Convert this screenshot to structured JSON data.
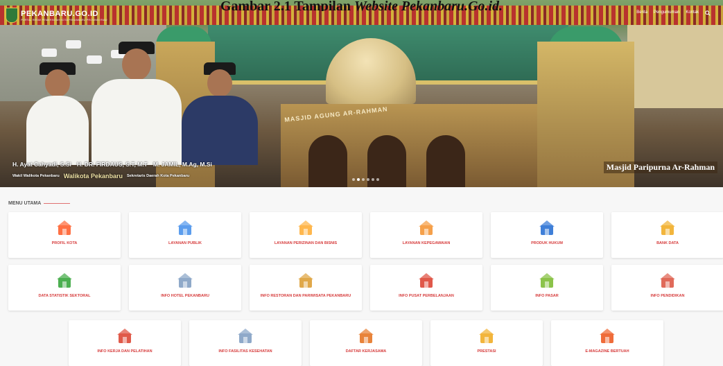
{
  "caption": {
    "prefix": "Gambar 2.1 Tampilan ",
    "italic": "Website Pekanbaru.Go.id."
  },
  "header": {
    "logo_title": "PEKANBARU.GO.ID",
    "logo_subtitle": "PORTAL RESMI PEMERINTAH KOTA PEKANBARU PROVINSI RIAU",
    "nav": [
      "Berita",
      "Pengumuman",
      "Kontak"
    ]
  },
  "hero": {
    "officials": [
      {
        "name": "H. Ayat Cahyadi, S.Si",
        "role": "Wakil Walikota Pekanbaru"
      },
      {
        "name": "H. DR. FIRDAUS, S.T, M.T",
        "role": "Walikota Pekanbaru"
      },
      {
        "name": "M. JAMIL, M.Ag, M.Si",
        "role": "Sekretaris Daerah Kota Pekanbaru"
      }
    ],
    "building_sign": "MASJID AGUNG AR-RAHMAN",
    "place_label": "Masjid Paripurna Ar-Rahman",
    "slide_count": 6,
    "active_slide": 1
  },
  "menu": {
    "title": "MENU UTAMA",
    "items": [
      {
        "label": "PROFIL KOTA",
        "icon": "home-icon",
        "color": "#ff7043"
      },
      {
        "label": "LAYANAN PUBLIK",
        "icon": "public-service-icon",
        "color": "#5c9ded"
      },
      {
        "label": "LAYANAN PERIZINAN DAN BISNIS",
        "icon": "business-permit-icon",
        "color": "#ffb74d"
      },
      {
        "label": "LAYANAN KEPEGAWAIAN",
        "icon": "employee-icon",
        "color": "#f5a04a"
      },
      {
        "label": "PRODUK HUKUM",
        "icon": "globe-law-icon",
        "color": "#3f7fd8"
      },
      {
        "label": "BANK DATA",
        "icon": "database-icon",
        "color": "#f2b53c"
      },
      {
        "label": "DATA STATISTIK SEKTORAL",
        "icon": "statistics-chart-icon",
        "color": "#4caf50"
      },
      {
        "label": "INFO HOTEL PEKANBARU",
        "icon": "hotel-icon",
        "color": "#8fa9c9"
      },
      {
        "label": "INFO RESTORAN DAN PARIWISATA PEKANBARU",
        "icon": "restaurant-icon",
        "color": "#e0a84a"
      },
      {
        "label": "INFO PUSAT PERBELANJAAN",
        "icon": "shop-icon",
        "color": "#e0584a"
      },
      {
        "label": "INFO PASAR",
        "icon": "market-icon",
        "color": "#8bc34a"
      },
      {
        "label": "INFO PENDIDIKAN",
        "icon": "school-icon",
        "color": "#e06a5a"
      },
      {
        "label": "INFO KERJA DAN PELATIHAN",
        "icon": "job-icon",
        "color": "#e05a4a"
      },
      {
        "label": "INFO FASILITAS KESEHATAN",
        "icon": "hospital-icon",
        "color": "#8fa9c9"
      },
      {
        "label": "DAFTAR KERJASAMA",
        "icon": "handshake-icon",
        "color": "#e8833a"
      },
      {
        "label": "PRESTASI",
        "icon": "medal-icon",
        "color": "#f2b53c"
      },
      {
        "label": "E-MAGAZINE BERTUAH",
        "icon": "magazine-icon",
        "color": "#ef6c3a"
      }
    ]
  }
}
